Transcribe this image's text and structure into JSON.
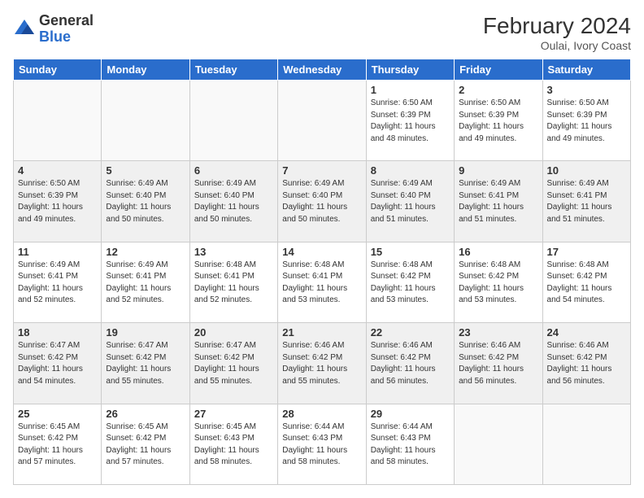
{
  "header": {
    "logo_general": "General",
    "logo_blue": "Blue",
    "month_year": "February 2024",
    "location": "Oulai, Ivory Coast"
  },
  "days_of_week": [
    "Sunday",
    "Monday",
    "Tuesday",
    "Wednesday",
    "Thursday",
    "Friday",
    "Saturday"
  ],
  "weeks": [
    [
      {
        "day": "",
        "info": ""
      },
      {
        "day": "",
        "info": ""
      },
      {
        "day": "",
        "info": ""
      },
      {
        "day": "",
        "info": ""
      },
      {
        "day": "1",
        "info": "Sunrise: 6:50 AM\nSunset: 6:39 PM\nDaylight: 11 hours\nand 48 minutes."
      },
      {
        "day": "2",
        "info": "Sunrise: 6:50 AM\nSunset: 6:39 PM\nDaylight: 11 hours\nand 49 minutes."
      },
      {
        "day": "3",
        "info": "Sunrise: 6:50 AM\nSunset: 6:39 PM\nDaylight: 11 hours\nand 49 minutes."
      }
    ],
    [
      {
        "day": "4",
        "info": "Sunrise: 6:50 AM\nSunset: 6:39 PM\nDaylight: 11 hours\nand 49 minutes."
      },
      {
        "day": "5",
        "info": "Sunrise: 6:49 AM\nSunset: 6:40 PM\nDaylight: 11 hours\nand 50 minutes."
      },
      {
        "day": "6",
        "info": "Sunrise: 6:49 AM\nSunset: 6:40 PM\nDaylight: 11 hours\nand 50 minutes."
      },
      {
        "day": "7",
        "info": "Sunrise: 6:49 AM\nSunset: 6:40 PM\nDaylight: 11 hours\nand 50 minutes."
      },
      {
        "day": "8",
        "info": "Sunrise: 6:49 AM\nSunset: 6:40 PM\nDaylight: 11 hours\nand 51 minutes."
      },
      {
        "day": "9",
        "info": "Sunrise: 6:49 AM\nSunset: 6:41 PM\nDaylight: 11 hours\nand 51 minutes."
      },
      {
        "day": "10",
        "info": "Sunrise: 6:49 AM\nSunset: 6:41 PM\nDaylight: 11 hours\nand 51 minutes."
      }
    ],
    [
      {
        "day": "11",
        "info": "Sunrise: 6:49 AM\nSunset: 6:41 PM\nDaylight: 11 hours\nand 52 minutes."
      },
      {
        "day": "12",
        "info": "Sunrise: 6:49 AM\nSunset: 6:41 PM\nDaylight: 11 hours\nand 52 minutes."
      },
      {
        "day": "13",
        "info": "Sunrise: 6:48 AM\nSunset: 6:41 PM\nDaylight: 11 hours\nand 52 minutes."
      },
      {
        "day": "14",
        "info": "Sunrise: 6:48 AM\nSunset: 6:41 PM\nDaylight: 11 hours\nand 53 minutes."
      },
      {
        "day": "15",
        "info": "Sunrise: 6:48 AM\nSunset: 6:42 PM\nDaylight: 11 hours\nand 53 minutes."
      },
      {
        "day": "16",
        "info": "Sunrise: 6:48 AM\nSunset: 6:42 PM\nDaylight: 11 hours\nand 53 minutes."
      },
      {
        "day": "17",
        "info": "Sunrise: 6:48 AM\nSunset: 6:42 PM\nDaylight: 11 hours\nand 54 minutes."
      }
    ],
    [
      {
        "day": "18",
        "info": "Sunrise: 6:47 AM\nSunset: 6:42 PM\nDaylight: 11 hours\nand 54 minutes."
      },
      {
        "day": "19",
        "info": "Sunrise: 6:47 AM\nSunset: 6:42 PM\nDaylight: 11 hours\nand 55 minutes."
      },
      {
        "day": "20",
        "info": "Sunrise: 6:47 AM\nSunset: 6:42 PM\nDaylight: 11 hours\nand 55 minutes."
      },
      {
        "day": "21",
        "info": "Sunrise: 6:46 AM\nSunset: 6:42 PM\nDaylight: 11 hours\nand 55 minutes."
      },
      {
        "day": "22",
        "info": "Sunrise: 6:46 AM\nSunset: 6:42 PM\nDaylight: 11 hours\nand 56 minutes."
      },
      {
        "day": "23",
        "info": "Sunrise: 6:46 AM\nSunset: 6:42 PM\nDaylight: 11 hours\nand 56 minutes."
      },
      {
        "day": "24",
        "info": "Sunrise: 6:46 AM\nSunset: 6:42 PM\nDaylight: 11 hours\nand 56 minutes."
      }
    ],
    [
      {
        "day": "25",
        "info": "Sunrise: 6:45 AM\nSunset: 6:42 PM\nDaylight: 11 hours\nand 57 minutes."
      },
      {
        "day": "26",
        "info": "Sunrise: 6:45 AM\nSunset: 6:42 PM\nDaylight: 11 hours\nand 57 minutes."
      },
      {
        "day": "27",
        "info": "Sunrise: 6:45 AM\nSunset: 6:43 PM\nDaylight: 11 hours\nand 58 minutes."
      },
      {
        "day": "28",
        "info": "Sunrise: 6:44 AM\nSunset: 6:43 PM\nDaylight: 11 hours\nand 58 minutes."
      },
      {
        "day": "29",
        "info": "Sunrise: 6:44 AM\nSunset: 6:43 PM\nDaylight: 11 hours\nand 58 minutes."
      },
      {
        "day": "",
        "info": ""
      },
      {
        "day": "",
        "info": ""
      }
    ]
  ]
}
